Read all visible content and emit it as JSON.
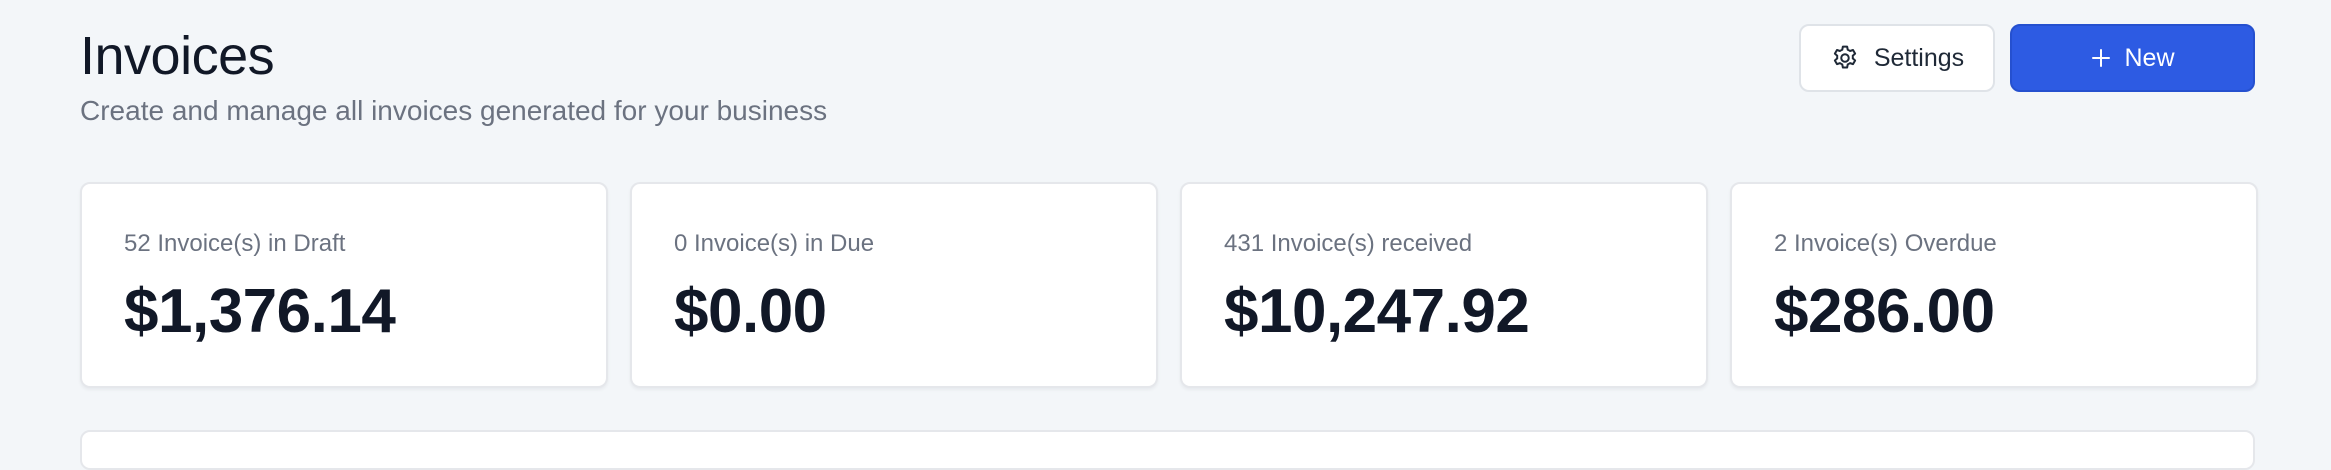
{
  "header": {
    "title": "Invoices",
    "subtitle": "Create and manage all invoices generated for your business"
  },
  "actions": {
    "settings_label": "Settings",
    "settings_icon": "gear-icon",
    "new_label": "New",
    "new_icon": "plus-icon"
  },
  "stats": [
    {
      "label": "52 Invoice(s) in Draft",
      "value": "$1,376.14"
    },
    {
      "label": "0 Invoice(s) in Due",
      "value": "$0.00"
    },
    {
      "label": "431 Invoice(s) received",
      "value": "$10,247.92"
    },
    {
      "label": "2 Invoice(s) Overdue",
      "value": "$286.00"
    }
  ],
  "colors": {
    "background": "#f3f6f9",
    "primary": "#2d5be3",
    "text": "#111827",
    "muted": "#6b7280"
  }
}
